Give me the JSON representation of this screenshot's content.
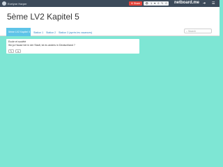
{
  "topbar": {
    "user_name": "Evelyne Harper",
    "share_label": "Share",
    "stats": [
      "1",
      "0",
      "0"
    ],
    "brand": "netboard.me"
  },
  "header": {
    "title": "5ème LV2 Kapitel 5"
  },
  "tabs": [
    {
      "label": "5ème LV2 Kapitel 5"
    },
    {
      "label": "Station 1"
    },
    {
      "label": "Station 2"
    },
    {
      "label": "Station 3 (après les vacances)"
    }
  ],
  "search": {
    "placeholder": "Search"
  },
  "card": {
    "line1": "Ecole et société",
    "line2": "Wo ja Hause bei in der Stadt, ist es anders in Deutschland ?"
  }
}
